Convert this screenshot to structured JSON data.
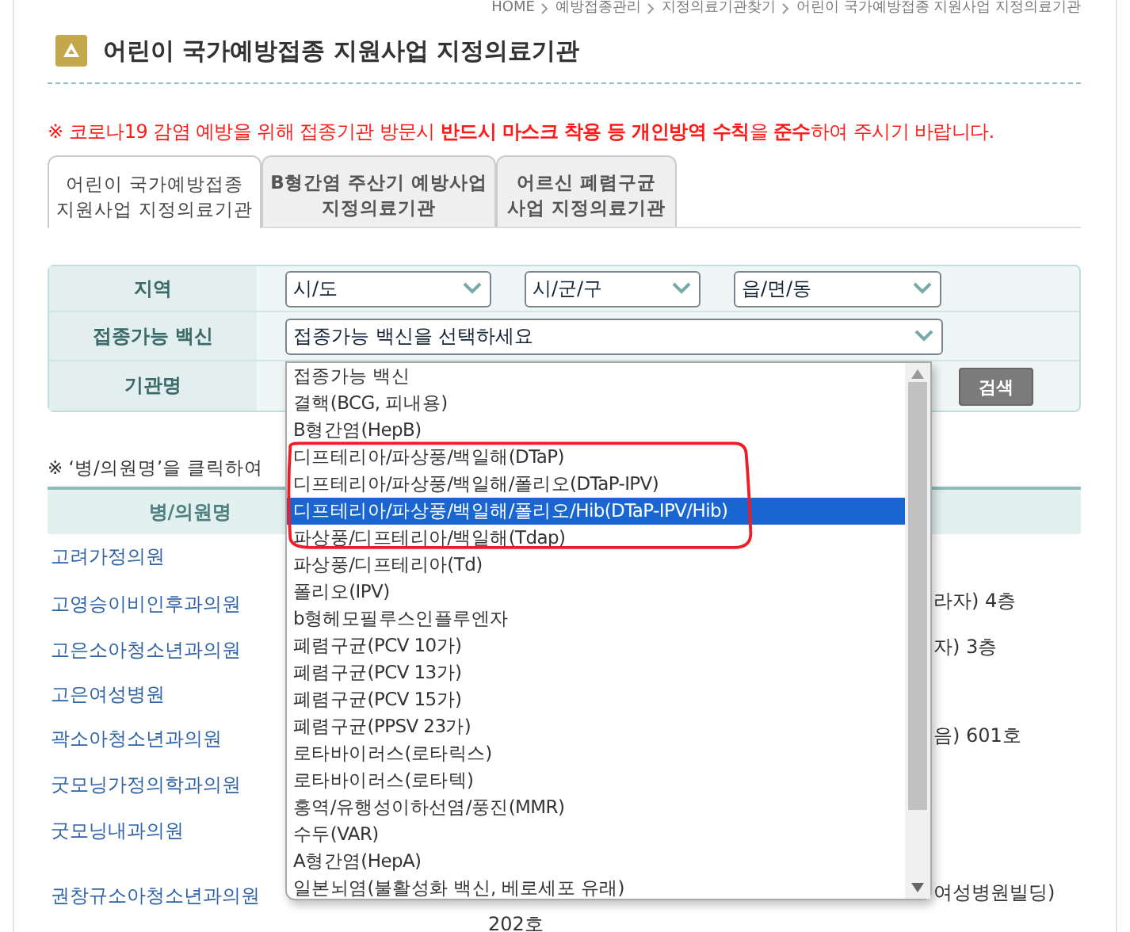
{
  "breadcrumb": [
    "HOME",
    "예방접종관리",
    "지정의료기관찾기",
    "어린이 국가예방접종 지원사업 지정의료기관"
  ],
  "title": "어린이 국가예방접종 지원사업 지정의료기관",
  "notice": "※ 코로나19 감염 예방을 위해 접종기관 방문시 **반드시 마스크 착용 등 개인방역 수칙**을 **준수**하여 주시기 바랍니다.",
  "tabs": [
    {
      "lines": [
        "어린이 국가예방접종",
        "지원사업 지정의료기관"
      ],
      "selected": true
    },
    {
      "lines": [
        "B형간염 주산기 예방사업",
        "지정의료기관"
      ],
      "selected": false
    },
    {
      "lines": [
        "어르신 폐렴구균",
        "사업 지정의료기관"
      ],
      "selected": false
    }
  ],
  "search": {
    "rows": [
      {
        "label": "지역",
        "kind": "region",
        "selects": [
          "시/도",
          "시/군/구",
          "읍/면/동"
        ]
      },
      {
        "label": "접종가능 백신",
        "kind": "vaccine",
        "selects": [
          "접종가능 백신을 선택하세요"
        ]
      },
      {
        "label": "기관명",
        "kind": "name"
      }
    ],
    "button": "검색"
  },
  "note": "※ ‘병/의원명’을 클릭하여",
  "table": {
    "columns": [
      "병/의원명"
    ],
    "rows": [
      {
        "name": "고려가정의원",
        "address": []
      },
      {
        "name": "고영승이비인후과의원",
        "address": [
          "라자) 4층"
        ]
      },
      {
        "name": "고은소아청소년과의원",
        "address": [
          "자) 3층"
        ]
      },
      {
        "name": "고은여성병원",
        "address": []
      },
      {
        "name": "곽소아청소년과의원",
        "address": [
          "음) 601호"
        ]
      },
      {
        "name": "굿모닝가정의학과의원",
        "address": []
      },
      {
        "name": "굿모닝내과의원",
        "address": []
      },
      {
        "name": "권창규소아청소년과의원",
        "address": [
          "여성병원빌딩)",
          "202호"
        ]
      }
    ]
  },
  "dropdown": {
    "options": [
      {
        "label": "접종가능 백신",
        "selected": false
      },
      {
        "label": "결핵(BCG, 피내용)",
        "selected": false
      },
      {
        "label": "B형간염(HepB)",
        "selected": false
      },
      {
        "label": "디프테리아/파상풍/백일해(DTaP)",
        "selected": false
      },
      {
        "label": "디프테리아/파상풍/백일해/폴리오(DTaP-IPV)",
        "selected": false
      },
      {
        "label": "디프테리아/파상풍/백일해/폴리오/Hib(DTaP-IPV/Hib)",
        "selected": true
      },
      {
        "label": "파상풍/디프테리아/백일해(Tdap)",
        "selected": false
      },
      {
        "label": "파상풍/디프테리아(Td)",
        "selected": false
      },
      {
        "label": "폴리오(IPV)",
        "selected": false
      },
      {
        "label": "b형헤모필루스인플루엔자",
        "selected": false
      },
      {
        "label": "폐렴구균(PCV 10가)",
        "selected": false
      },
      {
        "label": "폐렴구균(PCV 13가)",
        "selected": false
      },
      {
        "label": "폐렴구균(PCV 15가)",
        "selected": false
      },
      {
        "label": "폐렴구균(PPSV 23가)",
        "selected": false
      },
      {
        "label": "로타바이러스(로타릭스)",
        "selected": false
      },
      {
        "label": "로타바이러스(로타텍)",
        "selected": false
      },
      {
        "label": "홍역/유행성이하선염/풍진(MMR)",
        "selected": false
      },
      {
        "label": "수두(VAR)",
        "selected": false
      },
      {
        "label": "A형간염(HepA)",
        "selected": false
      },
      {
        "label": "일본뇌염(불활성화 백신, 베로세포 유래)",
        "selected": false
      }
    ]
  }
}
